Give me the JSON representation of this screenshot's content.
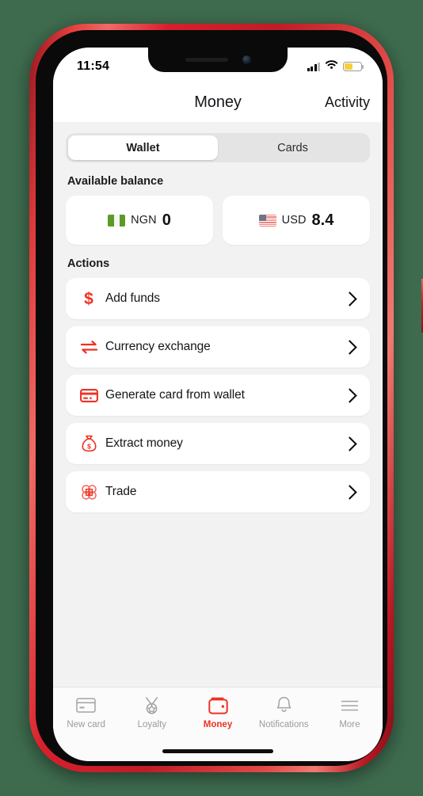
{
  "status_bar": {
    "time": "11:54",
    "signal_icon": "cellular-bars-icon",
    "signal_bars_filled": 3,
    "signal_bars_total": 4,
    "wifi_icon": "wifi-icon",
    "battery_icon": "battery-icon",
    "battery_percent": 52,
    "battery_color": "#f6cf3e"
  },
  "header": {
    "title": "Money",
    "activity_label": "Activity"
  },
  "segmented": {
    "tabs": [
      {
        "label": "Wallet",
        "active": true
      },
      {
        "label": "Cards",
        "active": false
      }
    ]
  },
  "balance": {
    "heading": "Available balance",
    "cards": [
      {
        "flag": "nigeria-flag-icon",
        "currency": "NGN",
        "amount": "0"
      },
      {
        "flag": "usa-flag-icon",
        "currency": "USD",
        "amount": "8.4"
      }
    ]
  },
  "actions": {
    "heading": "Actions",
    "items": [
      {
        "label": "Add funds",
        "icon": "dollar-sign-icon"
      },
      {
        "label": "Currency exchange",
        "icon": "exchange-arrows-icon"
      },
      {
        "label": "Generate card from wallet",
        "icon": "credit-card-icon"
      },
      {
        "label": "Extract money",
        "icon": "money-bag-icon"
      },
      {
        "label": "Trade",
        "icon": "trade-clover-icon"
      }
    ]
  },
  "tab_bar": {
    "items": [
      {
        "label": "New card",
        "icon": "card-icon",
        "active": false
      },
      {
        "label": "Loyalty",
        "icon": "medal-icon",
        "active": false
      },
      {
        "label": "Money",
        "icon": "wallet-icon",
        "active": true
      },
      {
        "label": "Notifications",
        "icon": "bell-icon",
        "active": false
      },
      {
        "label": "More",
        "icon": "hamburger-menu-icon",
        "active": false
      }
    ]
  },
  "colors": {
    "accent_red": "#ef3124",
    "device_body": "#d8202c",
    "page_background": "#f2f2f2",
    "backdrop": "#3e6b4e"
  }
}
